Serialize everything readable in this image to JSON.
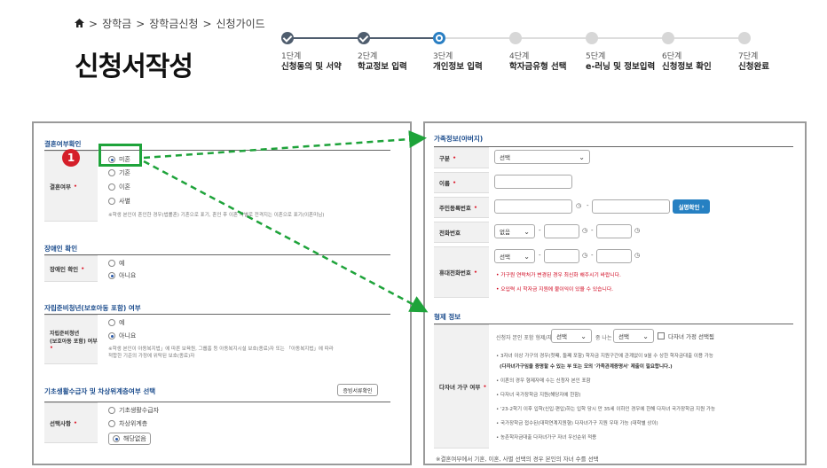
{
  "breadcrumb": [
    "장학금",
    "장학금신청",
    "신청가이드"
  ],
  "page_title": "신청서작성",
  "steps": [
    {
      "num": "1단계",
      "label": "신청동의 및 서약",
      "state": "done"
    },
    {
      "num": "2단계",
      "label": "학교정보 입력",
      "state": "done"
    },
    {
      "num": "3단계",
      "label": "개인정보 입력",
      "state": "current"
    },
    {
      "num": "4단계",
      "label": "학자금유형 선택",
      "state": "todo"
    },
    {
      "num": "5단계",
      "label": "e-러닝 및 정보입력",
      "state": "todo"
    },
    {
      "num": "6단계",
      "label": "신청정보 확인",
      "state": "todo"
    },
    {
      "num": "7단계",
      "label": "신청완료",
      "state": "todo"
    }
  ],
  "left": {
    "marriage": {
      "section": "결혼여부확인",
      "label": "결혼여부",
      "options": [
        "미혼",
        "기혼",
        "이혼",
        "사별"
      ],
      "selected": "미혼",
      "note": "※학생 본인이 혼인한 경우(법률혼) 기혼으로 표기, 혼인 후 이혼 사별로 전격지는 이혼으로 표기(이혼미님)"
    },
    "disability": {
      "section": "장애인 확인",
      "label": "장애인 확인",
      "options": [
        "예",
        "아니요"
      ],
      "selected": "아니요"
    },
    "selfreliance": {
      "section": "자립준비청년(보호아동 포함) 여부",
      "label_line1": "자립준비청년",
      "label_line2": "(보호아동 포함) 여부",
      "options": [
        "예",
        "아니요"
      ],
      "selected": "아니요",
      "note_line1": "※학생 본인이 아동복지법」에 따른 보육원, 그룹홈 등 아동복지시설 보호(종료)자 또는 「아동복지법」에 따라",
      "note_line2": "적합한 기준의 가정에 위탁된 보호(종료)자"
    },
    "basic": {
      "section": "기초생활수급자 및 차상위계층여부 선택",
      "cert_button": "증빙서류확인",
      "label": "선택사항",
      "options": [
        "기초생활수급자",
        "차상위계층",
        "해당없음"
      ],
      "selected": "해당없음"
    }
  },
  "right": {
    "family": {
      "section": "가족정보(아버지)",
      "type_label": "구분",
      "type_select": "선택",
      "name_label": "이름",
      "rrn_label": "주민등록번호",
      "verify_button": "실명확인",
      "phone_label": "전화번호",
      "phone_select": "없음",
      "mobile_label": "휴대전화번호",
      "mobile_select": "선택",
      "warn1": "• 가구원 연락처가 변경된 경우 최신화 해주시기 바랍니다.",
      "warn2": "• 오입력 시 학자금 지원에 불이익이 있을 수 있습니다."
    },
    "siblings": {
      "section": "형제 정보",
      "label": "다자녀 가구 여부",
      "count_text": "신청자 본인 포함 형제/자매",
      "select1": "선택",
      "order_text": "중 나는",
      "select2": "선택",
      "check_label": "다자녀 가정 선택됨",
      "bullets": [
        "• 3자녀 이상 가구의 경우(첫째, 둘째 포함) 학자금 지원구간에 관계없이 9월 수 상한 학자금대출 이용 가능",
        "(다자녀가구임을 증명할 수 있는 부 또는 모의 '가족관계증명서' 제출이 필요합니다.)",
        "• 이혼의 경우 형제자매 수는 신청자 본인 포함",
        "• 다자녀 국가장학금 지원(해당자에 한함)",
        "• '23-2학기 이후 입학(신입·편입)하는 입학 당시 만 35세 이하인 경우에 한해 다자녀 국가장학금 지원 가능",
        "• 국가장학금 접수된(대학연계지원형) 다자녀가구 지원 우대 가능 (대학별 상이)",
        "• 농촌학자금대출 다자녀가구 자녀 우선순위 적용"
      ],
      "footer": "※결혼여부에서 기혼, 이혼, 사별 선택의 경우 본인의 자녀 수를 선택"
    }
  },
  "annotation_number": "1",
  "colors": {
    "accent": "#2a7fc3",
    "highlight": "#1ea33a",
    "badge": "#d51f2a"
  }
}
